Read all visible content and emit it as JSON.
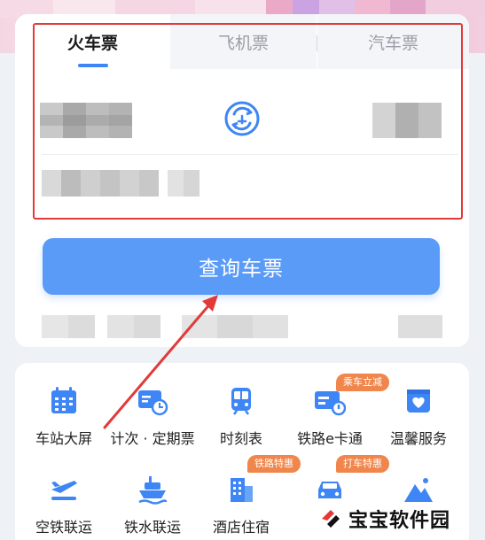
{
  "tabs": [
    {
      "label": "火车票",
      "active": true
    },
    {
      "label": "飞机票",
      "active": false
    },
    {
      "label": "汽车票",
      "active": false
    }
  ],
  "query_button": {
    "label": "查询车票"
  },
  "services": [
    {
      "label": "车站大屏",
      "icon": "station-screen-icon"
    },
    {
      "label": "计次 · 定期票",
      "icon": "ticket-clock-icon"
    },
    {
      "label": "时刻表",
      "icon": "train-icon"
    },
    {
      "label": "铁路e卡通",
      "icon": "ecard-icon",
      "badge": "乘车立减"
    },
    {
      "label": "温馨服务",
      "icon": "heart-box-icon"
    },
    {
      "label": "空铁联运",
      "icon": "plane-train-icon"
    },
    {
      "label": "铁水联运",
      "icon": "ship-icon"
    },
    {
      "label": "酒店住宿",
      "icon": "hotel-icon",
      "badge": "铁路特惠"
    },
    {
      "label": "",
      "icon": "car-icon",
      "badge": "打车特惠"
    },
    {
      "label": "",
      "icon": "mountain-icon"
    }
  ],
  "watermark": {
    "text": "宝宝软件园"
  },
  "colors": {
    "accent": "#3e86f5",
    "button": "#5b9bf8",
    "badge": "#f0864b",
    "annotation": "#e23a3a"
  }
}
